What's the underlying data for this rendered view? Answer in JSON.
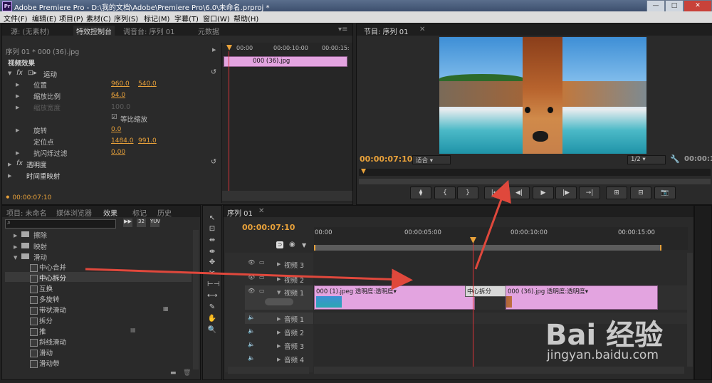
{
  "titlebar": {
    "title": "Adobe Premiere Pro - D:\\我的文档\\Adobe\\Premiere Pro\\6.0\\未命名.prproj *",
    "logo": "Pr",
    "min": "—",
    "max": "□",
    "close": "✕"
  },
  "menu": [
    "文件(F)",
    "编辑(E)",
    "项目(P)",
    "素材(C)",
    "序列(S)",
    "标记(M)",
    "字幕(T)",
    "窗口(W)",
    "帮助(H)"
  ],
  "effect_controls": {
    "tabs": [
      "源: (无素材)",
      "特效控制台",
      "调音台: 序列 01",
      "元数据"
    ],
    "clip_path": "序列 01 * 000 (36).jpg",
    "ruler_start": "00:00",
    "ruler_mid": "00:00:10:00",
    "ruler_end": "00:00:15:",
    "clip_label": "000 (36).jpg",
    "section": "视频效果",
    "motion": "运动",
    "rows": [
      {
        "label": "位置",
        "v1": "960.0",
        "v2": "540.0",
        "enabled": true
      },
      {
        "label": "缩放比例",
        "v1": "64.0",
        "v2": "",
        "enabled": true
      },
      {
        "label": "缩放宽度",
        "v1": "100.0",
        "v2": "",
        "enabled": false
      },
      {
        "label": "等比缩放",
        "v1": "",
        "v2": "",
        "enabled": true,
        "checkbox": true
      },
      {
        "label": "旋转",
        "v1": "0.0",
        "v2": "",
        "enabled": true
      },
      {
        "label": "定位点",
        "v1": "1484.0",
        "v2": "991.0",
        "enabled": true
      },
      {
        "label": "抗闪烁过滤",
        "v1": "0.00",
        "v2": "",
        "enabled": true
      }
    ],
    "opacity": "透明度",
    "time_remap": "时间重映射",
    "timecode": "00:00:07:10"
  },
  "program": {
    "tab": "节目: 序列 01",
    "timecode": "00:00:07:10",
    "fit": "适合",
    "quality": "1/2",
    "end_timecode": "00:00:1",
    "buttons": [
      "⧫",
      "{",
      "}",
      "|←",
      "◀|",
      "▶",
      "|▶",
      "→|",
      "⊞",
      "⊟",
      "📷"
    ]
  },
  "effects_panel": {
    "tabs": [
      "项目: 未命名",
      "媒体浏览器",
      "效果",
      "标记",
      "历史"
    ],
    "folders": [
      "擦除",
      "映射",
      "滑动"
    ],
    "items": [
      "中心合并",
      "中心拆分",
      "互换",
      "多旋转",
      "带状滑动",
      "拆分",
      "推",
      "斜线滑动",
      "滑动",
      "滑动带"
    ]
  },
  "tools": [
    "↖",
    "⊡",
    "⇹",
    "⇼",
    "✥",
    "✂",
    "⊢⊣",
    "⟷",
    "✎",
    "✋",
    "🔍"
  ],
  "timeline": {
    "tab": "序列 01",
    "timecode": "00:00:07:10",
    "ruler": [
      "00:00",
      "00:00:05:00",
      "00:00:10:00",
      "00:00:15:00"
    ],
    "video_tracks": [
      "视频 3",
      "视频 2",
      "视频 1"
    ],
    "audio_tracks": [
      "音频 1",
      "音频 2",
      "音频 3",
      "音频 4"
    ],
    "clip1": "000 (1).jpeg 透明度:透明度▾",
    "transition": "中心拆分",
    "clip2": "000 (36).jpg 透明度:透明度▾"
  },
  "watermark": {
    "brand": "Bai 经验",
    "url": "jingyan.baidu.com"
  },
  "colors": {
    "accent": "#e8a13a",
    "clip": "#e3a4e0",
    "arrow": "#e0483c",
    "playhead": "#d8343a"
  }
}
